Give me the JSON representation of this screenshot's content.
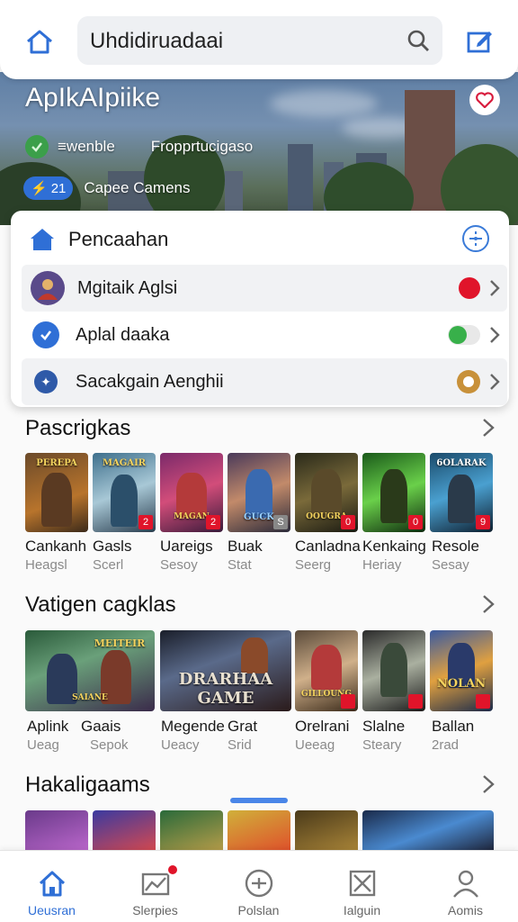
{
  "topbar": {
    "search_value": "Uhdidiruadaai",
    "home_icon": "home-icon",
    "search_icon": "search-icon",
    "edit_icon": "edit-icon"
  },
  "hero": {
    "title": "ApIkAIpiike",
    "status_left": "≡wenble",
    "status_right": "Fropprtucigaso",
    "count": "21",
    "caption": "Capee Camens"
  },
  "panel": {
    "title": "Pencaahan",
    "rows": [
      {
        "label": "Mgitaik Aglsi",
        "trailing": "red-dot"
      },
      {
        "label": "Aplal daaka",
        "trailing": "toggle-on"
      },
      {
        "label": "Sacakgain Aenghii",
        "trailing": "coin-badge"
      }
    ]
  },
  "section1": {
    "title": "Pascrigkas",
    "items": [
      {
        "name": "Cankanh",
        "sub": "Heagsl",
        "tag": "PEREPA",
        "badge": ""
      },
      {
        "name": "Gasls",
        "sub": "Scerl",
        "tag": "MAGAIR",
        "badge": "2"
      },
      {
        "name": "Uareigs",
        "sub": "Sesoy",
        "tag": "MAGAN",
        "badge": "2"
      },
      {
        "name": "Buak",
        "sub": "Stat",
        "tag": "GUCK",
        "badge": "S"
      },
      {
        "name": "Canladna",
        "sub": "Seerg",
        "tag": "OOUGRA",
        "badge": "0"
      },
      {
        "name": "Kenkaing",
        "sub": "Heriay",
        "tag": "",
        "badge": "0"
      },
      {
        "name": "Resole",
        "sub": "Sesay",
        "tag": "6OLARAK",
        "badge": "9"
      }
    ]
  },
  "section2": {
    "title": "Vatigen cagklas",
    "items": [
      {
        "name": "Aplink",
        "sub": "Ueag",
        "tag": "SAIANE"
      },
      {
        "name": "Gaais",
        "sub": "Sepok",
        "tag": "MEITEIR"
      },
      {
        "name": "Megende",
        "sub": "Ueacy",
        "tag": "DRARHAA GAME"
      },
      {
        "name": "Grat",
        "sub": "Srid",
        "tag": ""
      },
      {
        "name": "Orelrani",
        "sub": "Ueeag",
        "tag": "GILLOUNG"
      },
      {
        "name": "Slalne",
        "sub": "Steary",
        "tag": ""
      },
      {
        "name": "Ballan",
        "sub": "2rad",
        "tag": "NOLAN"
      }
    ]
  },
  "section3": {
    "title": "Hakaligaams"
  },
  "bottomnav": {
    "items": [
      {
        "label": "Ueusran",
        "icon": "home-icon"
      },
      {
        "label": "Slerpies",
        "icon": "chart-icon"
      },
      {
        "label": "Polslan",
        "icon": "add-circle-icon"
      },
      {
        "label": "Ialguin",
        "icon": "box-x-icon"
      },
      {
        "label": "Aomis",
        "icon": "profile-icon"
      }
    ]
  },
  "colors": {
    "accent": "#2f6fd6",
    "alert": "#e0142a",
    "success": "#38b04a"
  }
}
